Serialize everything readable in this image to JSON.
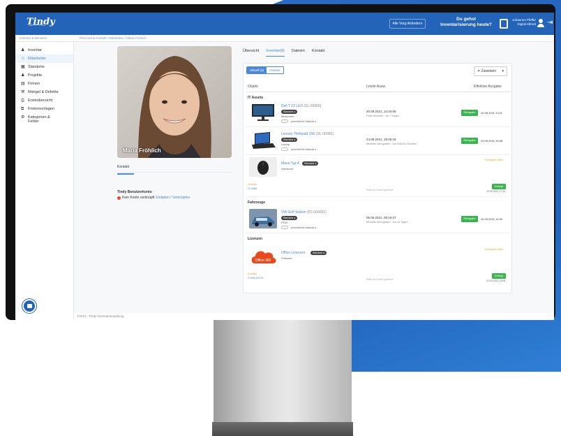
{
  "topbar": {
    "logo": "Tindy",
    "button_label": "Alle Vorg Anfordern",
    "question_line1": "Du gehst",
    "question_line2": "Inventarisierung heute?",
    "user_line1": "Johannes Pfeffer",
    "user_line2": "Digital Allrord"
  },
  "breadcrumb": {
    "left": "Inventar & Benutzer",
    "right": "Personal & Kontakt / Mitarbeiter / Maria Fröhlich"
  },
  "sidebar": {
    "items": [
      {
        "icon": "users-icon",
        "glyph": "♟",
        "label": "Inventar"
      },
      {
        "icon": "person-icon",
        "glyph": "☺",
        "label": "Mitarbeiter"
      },
      {
        "icon": "building-icon",
        "glyph": "▦",
        "label": "Standorte"
      },
      {
        "icon": "people-icon",
        "glyph": "♟",
        "label": "Projekte"
      },
      {
        "icon": "grid-icon",
        "glyph": "▤",
        "label": "Firmen"
      },
      {
        "icon": "wrench-icon",
        "glyph": "⚒",
        "label": "Mängel & Defekte"
      },
      {
        "icon": "printer-icon",
        "glyph": "⎙",
        "label": "Ersteübersicht"
      },
      {
        "icon": "copy-icon",
        "glyph": "⧉",
        "label": "Fristenvorlagen"
      },
      {
        "icon": "gear-icon",
        "glyph": "⚙",
        "label": "Kategorien & Felder"
      }
    ],
    "active_index": 1
  },
  "footer": "©2021 - Tindy Inventarverwaltung",
  "profile": {
    "name": "Maria Fröhlich",
    "kontakt_label": "Kontakt",
    "bm_title": "Tindy Benutzerkonto",
    "bm_text": "Kein Konto verknüpft",
    "bm_link": "Einladen / Verknüpfen"
  },
  "tabs": [
    "Übersicht",
    "Inventar(8)",
    "Dateien",
    "Kontakt"
  ],
  "active_tab": 1,
  "panel": {
    "seg_on": "Aktuell (5)",
    "seg_off": "Historie",
    "zoom_label": "Zuweisen",
    "col_object": "Objekt",
    "col_last_use": "Letzte Ausw.",
    "col_effective": "Effektive Ausgabe",
    "groups": [
      {
        "label": "IT Assets"
      },
      {
        "label": "Fahrzeuge"
      },
      {
        "label": "Lizenzen"
      }
    ],
    "items": [
      {
        "title": "Dell T 22 LED",
        "id": "(SL-00060)",
        "badge": "Standard ●",
        "sub": "Bildschirm",
        "pers": "persönliches Material ●",
        "last_use": "20.08.2021, 14:34:08",
        "last_use_sub": "Pelle Mohnsel · vor 7 Tagen",
        "button": "Rückgabe",
        "date": "20.08.2021 13:11"
      },
      {
        "title": "Lenovo Thinkpad 15E",
        "id": "(SL-00065)",
        "badge": "Standard ●",
        "sub": "Laptop",
        "pers": "persönliches Material ●",
        "last_use": "24.08.2021, 19:45:18",
        "last_use_sub": "Michelle Weingarten · vor 3Std 41 Stunden",
        "button": "Rückgabe",
        "date": "24.05.2021 15:08"
      },
      {
        "title": "Maus Typ A",
        "badge": "Standard ●",
        "sub": "Hardware",
        "status": "Rückgabe offen",
        "link_label": "Einsatz",
        "link_value": "G-3968",
        "gray": "Bitte auf nicht gesetzt",
        "btn2": "Erledigt",
        "date2": "20.03.2021 17:15"
      },
      {
        "title": "VW Golf Sieben",
        "id": "(FZ-000001)",
        "badge": "Standard ●",
        "sub": "PKW",
        "pers": "persönliches Material ●",
        "last_use": "05.05.2021, 09:16:27",
        "last_use_sub": "Michelle Weingarten · vor 12 Tagen",
        "button": "Rückgabe",
        "date": "20.03.2021 14:00"
      },
      {
        "title": "Office Lizenzen",
        "badge": "Standard ●",
        "sub": "Software",
        "status": "Rückgabe offen",
        "link_label": "Einsatz",
        "link_value": "S-N/A-20.03",
        "gray": "Bitte auf nicht gesetzt",
        "btn2": "Erledigt",
        "date2": "20.03.2021 13:08",
        "thumb_text": "Office 365"
      }
    ]
  }
}
